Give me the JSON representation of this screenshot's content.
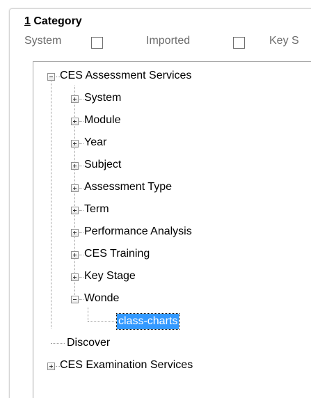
{
  "category": {
    "accelerator": "1",
    "title": " Category"
  },
  "filters": [
    {
      "label": "System"
    },
    {
      "label": "Imported"
    },
    {
      "label": "Key S"
    }
  ],
  "tree": {
    "root": "CES Assessment Services",
    "children": [
      "System",
      "Module",
      "Year",
      "Subject",
      "Assessment Type",
      "Term",
      "Performance Analysis",
      "CES Training",
      "Key Stage",
      "Wonde"
    ],
    "wonde_child": "class-charts",
    "discover": "Discover",
    "exam_root": "CES Examination Services"
  },
  "colors": {
    "selection": "#3399ff",
    "text": "#000000",
    "muted": "#6b6b6b"
  }
}
